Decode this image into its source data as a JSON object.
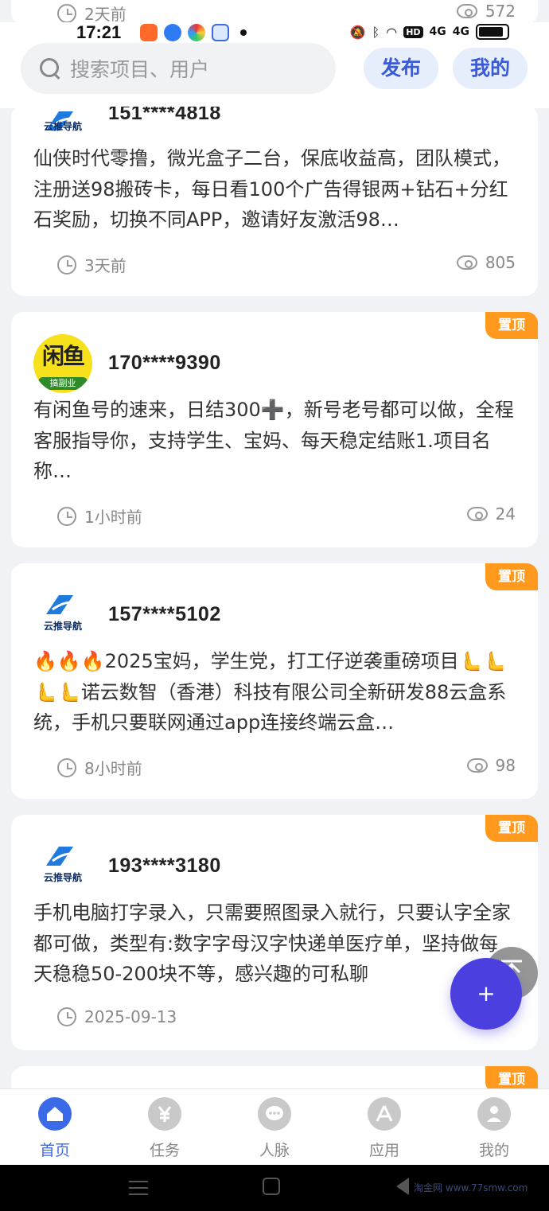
{
  "status_bar": {
    "time": "17:21",
    "network_badge": "HD",
    "signal_1": "4G",
    "signal_2": "4G"
  },
  "header": {
    "search_placeholder": "搜索项目、用户",
    "publish_label": "发布",
    "mine_label": "我的"
  },
  "peek_card": {
    "time": "2天前",
    "views": "572"
  },
  "cards": [
    {
      "user": "151****4818",
      "text": "仙侠时代零撸，微光盒子二台，保底收益高，团队模式，注册送98搬砖卡，每日看100个广告得银两+钻石+分红石奖励，切换不同APP，邀请好友激活98…",
      "time": "3天前",
      "views": "805",
      "pinned": false,
      "avatar": "logo",
      "avatar_text": "云推导航"
    },
    {
      "user": "170****9390",
      "text": "有闲鱼号的速来，日结300➕，新号老号都可以做，全程客服指导你，支持学生、宝妈、每天稳定结账1.项目名称…",
      "time": "1小时前",
      "views": "24",
      "pinned": true,
      "pin_label": "置顶",
      "avatar": "fish",
      "avatar_title": "闲鱼",
      "avatar_sub": "搞副业"
    },
    {
      "user": "157****5102",
      "text": "🔥🔥🔥2025宝妈，学生党，打工仔逆袭重磅项目🫷🫷🫷🫷诺云数智（香港）科技有限公司全新研发88云盒系统，手机只要联网通过app连接终端云盒…",
      "time": "8小时前",
      "views": "98",
      "pinned": true,
      "pin_label": "置顶",
      "avatar": "logo",
      "avatar_text": "云推导航"
    },
    {
      "user": "193****3180",
      "text": "手机电脑打字录入，只需要照图录入就行，只要认字全家都可做，类型有:数字字母汉字快递单医疗单，坚持做每天稳稳50-200块不等，感兴趣的可私聊",
      "time": "2025-09-13",
      "views": "",
      "pinned": true,
      "pin_label": "置顶",
      "avatar": "logo",
      "avatar_text": "云推导航"
    }
  ],
  "next_card": {
    "pin_label": "置顶"
  },
  "fab": {
    "add_label": "+"
  },
  "tabs": [
    {
      "label": "首页",
      "icon": "home-icon",
      "active": true
    },
    {
      "label": "任务",
      "icon": "yen-icon",
      "active": false
    },
    {
      "label": "人脉",
      "icon": "chat-icon",
      "active": false
    },
    {
      "label": "应用",
      "icon": "apps-icon",
      "active": false
    },
    {
      "label": "我的",
      "icon": "user-icon",
      "active": false
    }
  ],
  "watermark": "淘金网 www.77smw.com",
  "colors": {
    "accent": "#3a6ae8",
    "pin": "#ff9a1e",
    "fab": "#4b3fe0"
  }
}
